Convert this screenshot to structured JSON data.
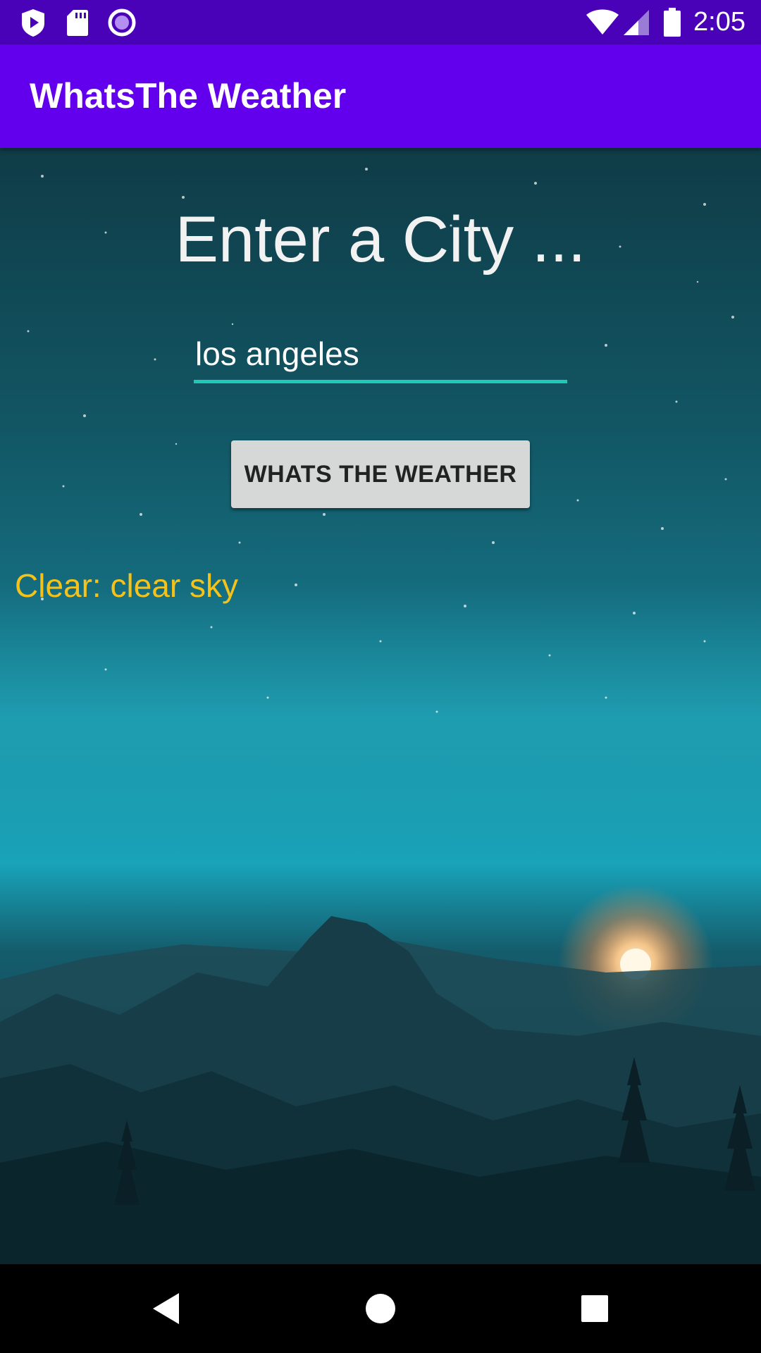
{
  "status_bar": {
    "time": "2:05",
    "icons_left": [
      "play-shield-icon",
      "sd-card-icon",
      "circle-record-icon"
    ],
    "icons_right": [
      "wifi-icon",
      "signal-icon",
      "battery-icon"
    ]
  },
  "app_bar": {
    "title": "WhatsThe Weather",
    "color": "#6200ee"
  },
  "main": {
    "heading": "Enter a City ...",
    "city_input": {
      "value": "los angeles",
      "placeholder": ""
    },
    "button_label": "WHATS THE WEATHER",
    "result_text": "Clear: clear sky",
    "result_color": "#f5c21b"
  },
  "nav_bar": {
    "buttons": [
      "back-icon",
      "home-icon",
      "recents-icon"
    ]
  }
}
